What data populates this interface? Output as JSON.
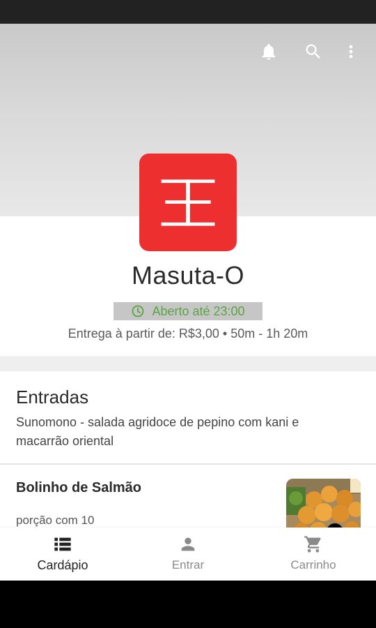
{
  "header": {
    "actions": [
      {
        "icon": "bell-icon"
      },
      {
        "icon": "search-icon"
      },
      {
        "icon": "more-vert-icon"
      }
    ]
  },
  "store": {
    "name": "Masuta-O",
    "logo_color": "#ee2f2f",
    "open_status": "Aberto até 23:00",
    "open_color": "#5ca345",
    "delivery_info": "Entrega à partir de: R$3,00 • 50m - 1h 20m"
  },
  "menu": {
    "section_title": "Entradas",
    "section_description": "Sunomono - salada agridoce de pepino com kani e macarrão oriental",
    "products": [
      {
        "name": "Bolinho de Salmão",
        "description": "porção com 10"
      }
    ]
  },
  "bottom_nav": {
    "items": [
      {
        "label": "Cardápio",
        "icon": "list-icon",
        "active": true
      },
      {
        "label": "Entrar",
        "icon": "person-icon",
        "active": false
      },
      {
        "label": "Carrinho",
        "icon": "cart-icon",
        "active": false
      }
    ]
  }
}
